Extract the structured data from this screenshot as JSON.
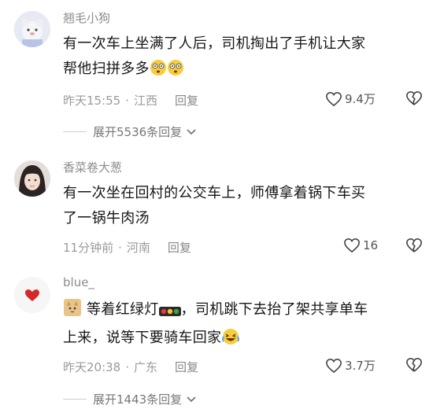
{
  "comments": [
    {
      "username": "翘毛小狗",
      "text1": "有一次车上坐满了人后，司机掏出了手机让大家",
      "text2": "帮他扫拼多多",
      "time": "昨天15:55",
      "location": "江西",
      "reply": "回复",
      "likes": "9.4万",
      "expand": "展开5536条回复",
      "avatar_icon": "cartoon-bear-avatar"
    },
    {
      "username": "香菜卷大葱",
      "text1": "有一次坐在回村的公交车上，师傅拿着锅下车买",
      "text2": "了一锅牛肉汤",
      "time": "11分钟前",
      "location": "河南",
      "reply": "回复",
      "likes": "16",
      "avatar_icon": "girl-photo-avatar"
    },
    {
      "username": "blue_",
      "text1": "等着红绿灯",
      "text1b": "，司机跳下去抬了架共享单车",
      "text2": "上来，说等下要骑车回家",
      "time": "昨天20:38",
      "location": "广东",
      "reply": "回复",
      "likes": "3.7万",
      "expand": "展开1443条回复",
      "avatar_icon": "red-heart-avatar"
    }
  ],
  "icons": {
    "like": "heart-outline-icon",
    "dislike": "broken-heart-icon",
    "expand": "chevron-down-icon",
    "emoji1": "dizzy-face-emoji",
    "emoji2": "cat-emoji",
    "emoji3": "traffic-light-emoji",
    "emoji4": "laughing-crying-emoji"
  }
}
